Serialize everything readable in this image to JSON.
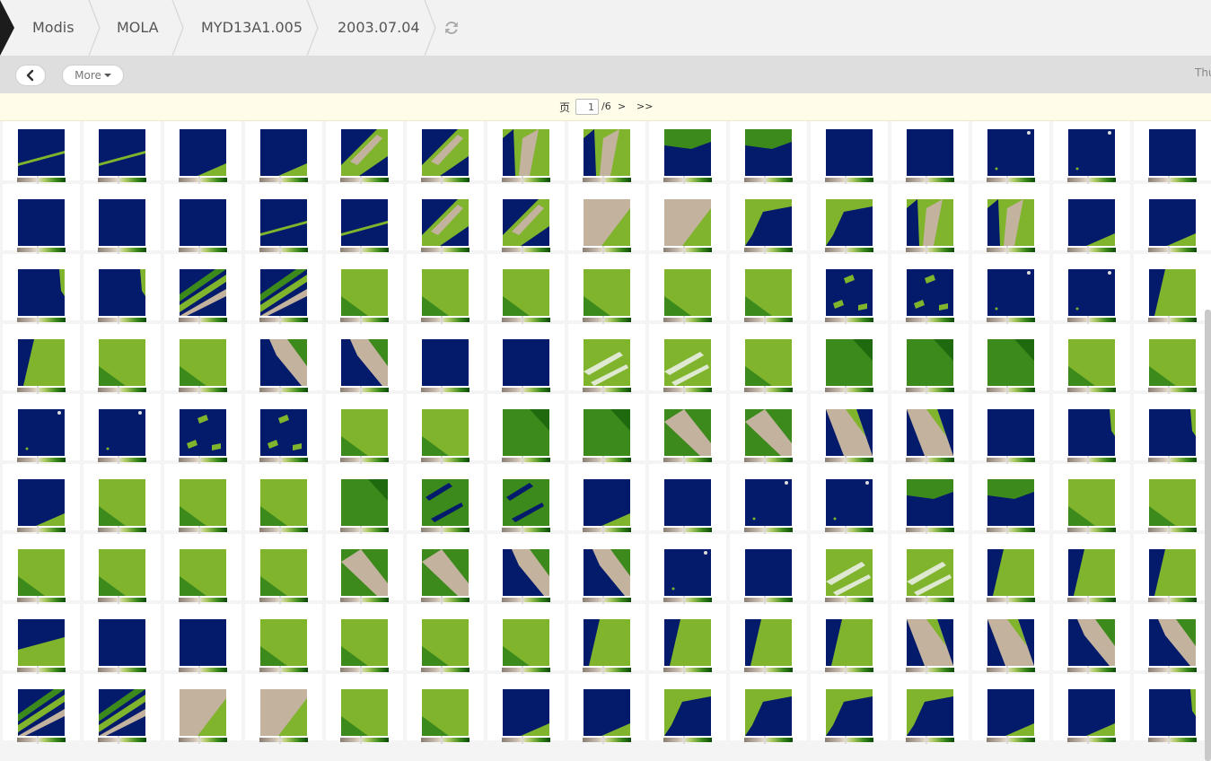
{
  "breadcrumb": {
    "items": [
      "Modis",
      "MOLA",
      "MYD13A1.005",
      "2003.07.04"
    ]
  },
  "toolbar": {
    "more_label": "More",
    "thumbnail_label": "Thu"
  },
  "pagination": {
    "page_label": "页",
    "current_page": "1",
    "total": "/6",
    "next": ">",
    "last": ">>"
  },
  "grid": {
    "columns": 15,
    "rows": 9,
    "ocean_color": "#041a6b",
    "vegetation_color": "#3c8a1c",
    "desert_color": "#c3b29e",
    "row_patterns": [
      [
        "sliver-diag",
        "sliver-diag",
        "ocean-corner-veg",
        "ocean-corner-veg",
        "land-band",
        "land-band",
        "land-center",
        "land-center",
        "veg-top",
        "veg-top",
        "ocean",
        "ocean",
        "ocean-dots",
        "ocean-dots",
        "ocean"
      ],
      [
        "ocean",
        "ocean",
        "ocean",
        "sliver-diag",
        "sliver-diag",
        "land-band",
        "land-band",
        "desert-veg",
        "desert-veg",
        "coast-top",
        "coast-top",
        "land-center",
        "land-center",
        "ocean-corner-veg",
        "ocean-corner-veg"
      ],
      [
        "ocean-edge",
        "ocean-edge",
        "land-strips",
        "land-strips",
        "veg-full",
        "veg-full",
        "veg-full",
        "veg-full",
        "veg-full",
        "veg-full",
        "islands",
        "islands",
        "ocean-dots",
        "ocean-dots",
        "veg-coast"
      ],
      [
        "veg-coast",
        "veg-full",
        "veg-full",
        "ocean-ridge",
        "ocean-ridge",
        "ocean",
        "ocean",
        "veg-streaks",
        "veg-streaks",
        "veg-full",
        "veg-dark",
        "veg-dark",
        "veg-dark",
        "veg-full",
        "veg-full"
      ],
      [
        "ocean-dots",
        "ocean-dots",
        "islands",
        "islands",
        "veg-full",
        "veg-full",
        "veg-dark",
        "veg-dark",
        "desert-diag",
        "desert-diag",
        "desert-left",
        "desert-left",
        "ocean",
        "ocean-edge",
        "ocean-edge"
      ],
      [
        "ocean-corner-veg",
        "veg-full",
        "veg-full",
        "veg-full",
        "veg-dark",
        "veg-lakes",
        "veg-lakes",
        "ocean-corner-veg",
        "ocean",
        "ocean-dots",
        "ocean-dots",
        "veg-top",
        "veg-top",
        "veg-full",
        "veg-full"
      ],
      [
        "veg-full",
        "veg-full",
        "veg-full",
        "veg-full",
        "desert-diag",
        "desert-diag",
        "ocean-ridge",
        "ocean-ridge",
        "ocean-dots",
        "ocean",
        "veg-streaks",
        "veg-streaks",
        "veg-coast",
        "veg-coast",
        "veg-coast"
      ],
      [
        "veg-strip",
        "ocean",
        "ocean",
        "veg-full",
        "veg-full",
        "veg-full",
        "veg-full",
        "veg-coast",
        "veg-coast",
        "veg-coast",
        "veg-coast",
        "desert-left",
        "desert-left",
        "ocean-ridge",
        "ocean-ridge"
      ],
      [
        "land-strips",
        "land-strips",
        "desert-veg",
        "desert-veg",
        "veg-full",
        "veg-full",
        "ocean-corner-veg",
        "ocean-corner-veg",
        "coast-top",
        "coast-top",
        "coast-top",
        "coast-top",
        "ocean-corner-veg",
        "ocean-corner-veg",
        "ocean-edge"
      ]
    ]
  }
}
